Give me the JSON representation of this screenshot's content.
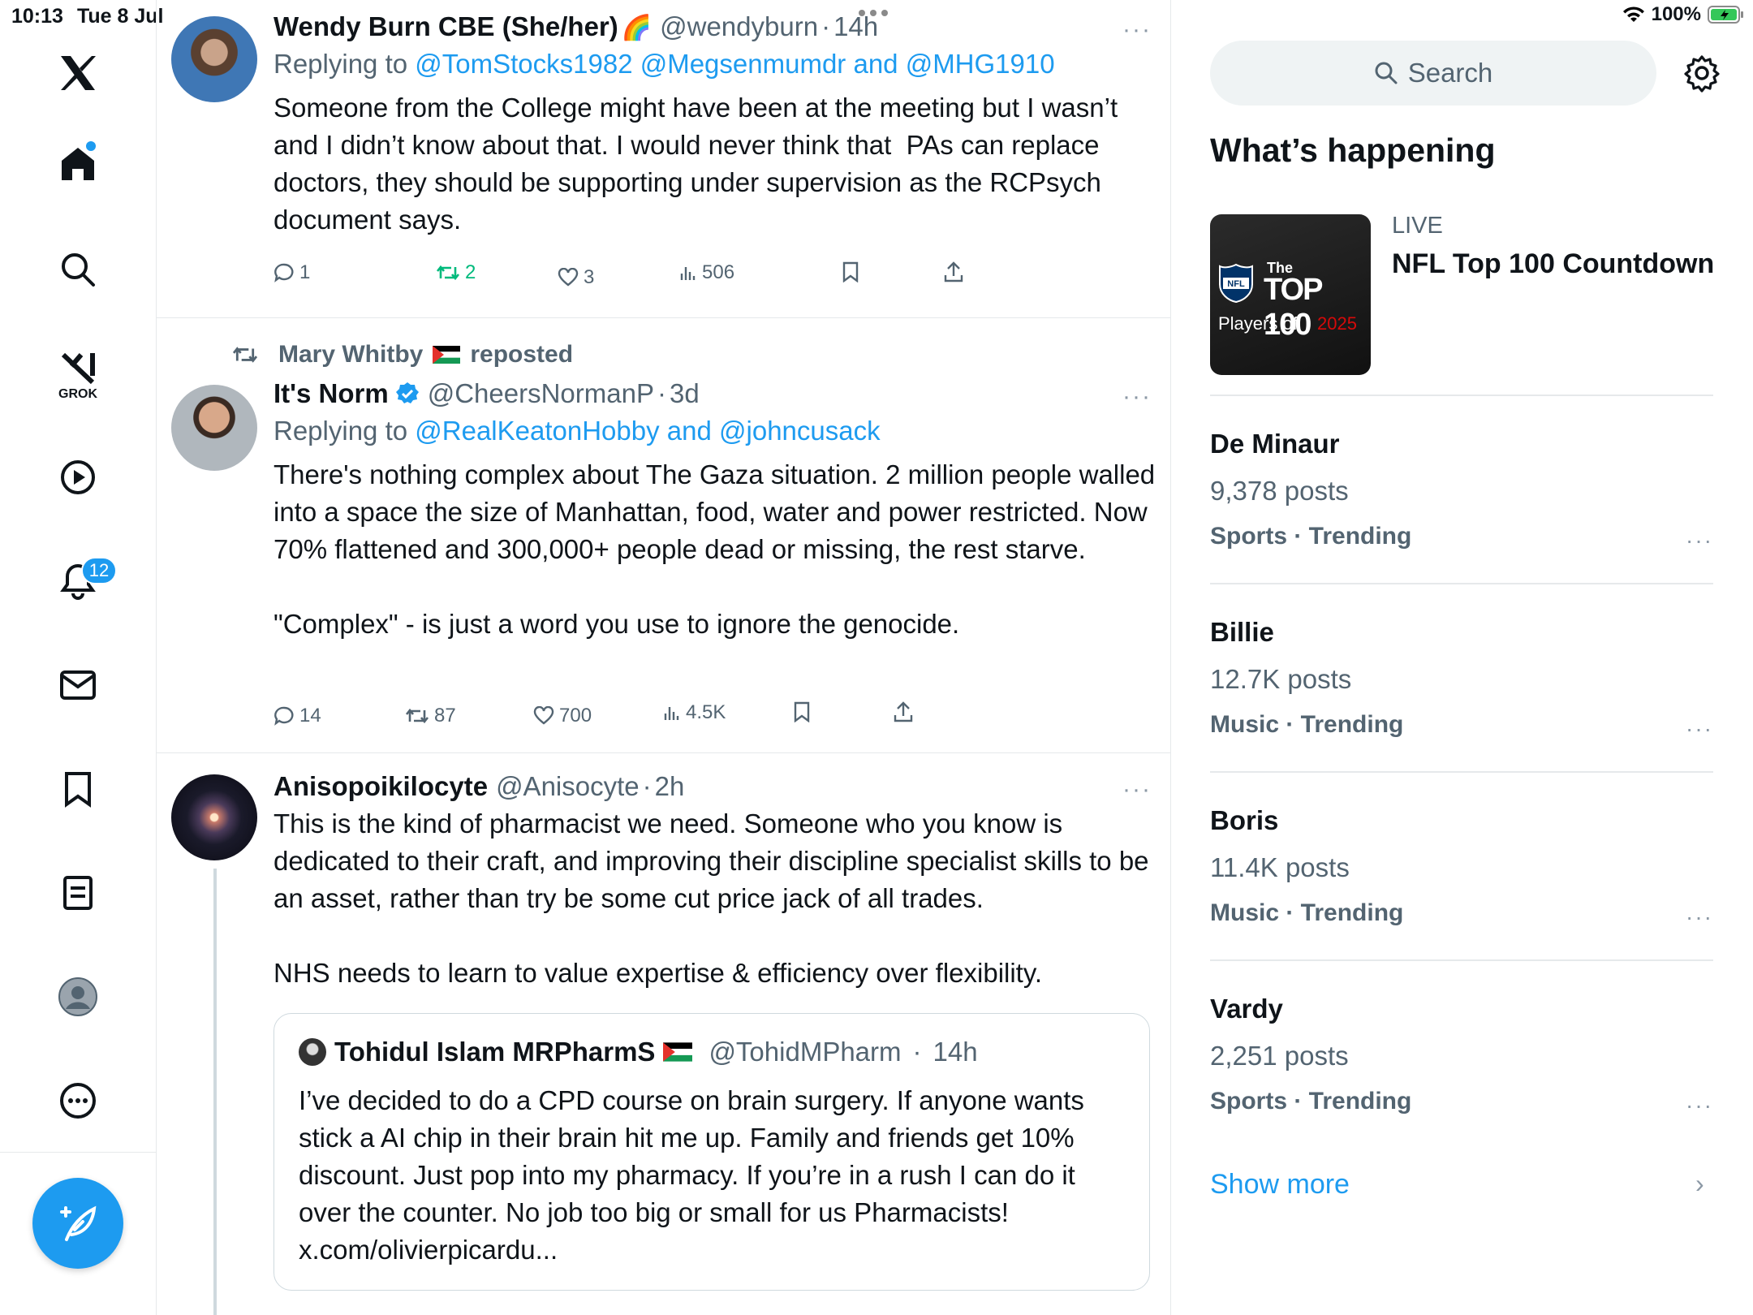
{
  "status": {
    "time": "10:13",
    "date": "Tue 8 Jul",
    "battery": "100%"
  },
  "nav": {
    "items": [
      "home-icon",
      "search-icon",
      "grok-icon",
      "video-icon",
      "notifications-icon",
      "messages-icon",
      "bookmarks-icon",
      "lists-icon",
      "profile-icon",
      "more-icon"
    ],
    "grok_label": "GROK",
    "notifications_badge": "12"
  },
  "tweets": [
    {
      "name": "Wendy Burn CBE (She/her)",
      "emoji": "🌈",
      "handle": "@wendyburn",
      "time": "14h",
      "reply_prefix": "Replying to ",
      "reply_to": "@TomStocks1982 @Megsenmumdr and @MHG1910",
      "text": "Someone from the College might have been at the meeting but I wasn’t and I didn’t know about that. I would never think that  PAs can replace doctors, they should be supporting under supervision as the RCPsych document says.",
      "replies": "1",
      "reposts": "2",
      "likes": "3",
      "views": "506"
    },
    {
      "reposted_by": "Mary Whitby",
      "reposted_label": "reposted",
      "name": "It's Norm",
      "handle": "@CheersNormanP",
      "time": "3d",
      "reply_prefix": "Replying to ",
      "reply_to": "@RealKeatonHobby and @johncusack",
      "text": "There's nothing complex about The Gaza situation. 2 million people walled into a space the size of Manhattan, food, water and power restricted. Now 70% flattened and 300,000+ people dead or missing, the rest starve.\n\n\"Complex\" - is just a word you use to ignore the genocide.",
      "replies": "14",
      "reposts": "87",
      "likes": "700",
      "views": "4.5K"
    },
    {
      "name": "Anisopoikilocyte",
      "handle": "@Anisocyte",
      "time": "2h",
      "text": "This is the kind of pharmacist we need. Someone who you know is dedicated to their craft, and improving their discipline specialist skills to be an asset, rather than try be some cut price jack of all trades.\n\nNHS needs to learn to value expertise & efficiency over flexibility.",
      "quote": {
        "name": "Tohidul Islam MRPharmS",
        "handle": "@TohidMPharm",
        "time": "14h",
        "text": "I’ve decided to do a CPD course on brain surgery. If anyone wants stick a AI chip in their brain hit me up. Family and friends get 10% discount. Just pop into my pharmacy. If you’re in a rush I can do it over the counter. No job too big or small for us Pharmacists! x.com/olivierpicardu..."
      }
    }
  ],
  "sidebar": {
    "search_placeholder": "Search",
    "whats_happening": "What’s happening",
    "live": {
      "label": "LIVE",
      "title": "NFL Top 100 Countdown",
      "image_text_the": "The",
      "image_text_top": "TOP 100",
      "image_text_players": "Players of",
      "image_text_year": "2025",
      "image_text_nfl": "NFL"
    },
    "trends": [
      {
        "name": "De Minaur",
        "posts": "9,378 posts",
        "category": "Sports · Trending"
      },
      {
        "name": "Billie",
        "posts": "12.7K posts",
        "category": "Music · Trending"
      },
      {
        "name": "Boris",
        "posts": "11.4K posts",
        "category": "Music · Trending"
      },
      {
        "name": "Vardy",
        "posts": "2,251 posts",
        "category": "Sports · Trending"
      }
    ],
    "show_more": "Show more"
  },
  "colors": {
    "accent": "#1d9bf0",
    "repost_active": "#00ba7c",
    "secondary_text": "#536471"
  }
}
